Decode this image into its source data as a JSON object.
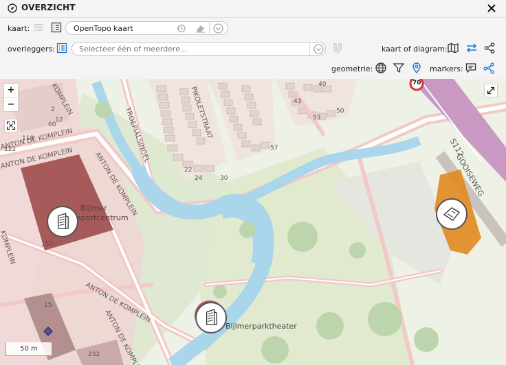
{
  "window": {
    "title": "OVERZICHT",
    "icon": "compass-icon",
    "close_icon": "close-icon"
  },
  "toolbar": {
    "map_label": "kaart:",
    "map_value": "OpenTopo kaart",
    "overlay_label": "overleggers:",
    "overlay_placeholder": "Selecteer één of meerdere...",
    "view_label": "kaart of diagram:",
    "geometry_label": "geometrie:",
    "markers_label": "markers:"
  },
  "map": {
    "labels": {
      "troepialsingel": "TROEPIALSINGEL",
      "pikoletstraat": "PIKOLETSTRAAT",
      "komplein_1": "ANTON DE KOMPLEIN",
      "komplein_2": "ANTON DE KOMPLEIN",
      "komplein_3": "ANTON DE KOMPLEIN",
      "komplein_4": "KOMPLEIN",
      "komplein_5": "ANTON DE KOMPLEIN",
      "komplein_6": "ANTON DE KOMPLEIN",
      "komplein_top": "KOMPLEIN",
      "bijlmer": "Bijlmer",
      "sportcentrum": "sportcentrum",
      "theater": "Bijlmerparktheater",
      "gooiseweg": "GOOISEWEG",
      "s112": "S112",
      "speed": "70",
      "n118": "118",
      "n122": "122",
      "n60": "60",
      "n12": "12",
      "n2": "2",
      "n157": "157",
      "n15": "15",
      "n232": "232",
      "n40": "40",
      "n43": "43",
      "n53": "53",
      "n50": "50",
      "n24": "24",
      "n30": "30",
      "n57": "57",
      "n22": "22"
    },
    "scale": "50 m",
    "zoom_in": "+",
    "zoom_out": "−",
    "accent_color": "#1a73c9",
    "building_color": "#a65a5a",
    "highlight_color": "#e08a20"
  }
}
